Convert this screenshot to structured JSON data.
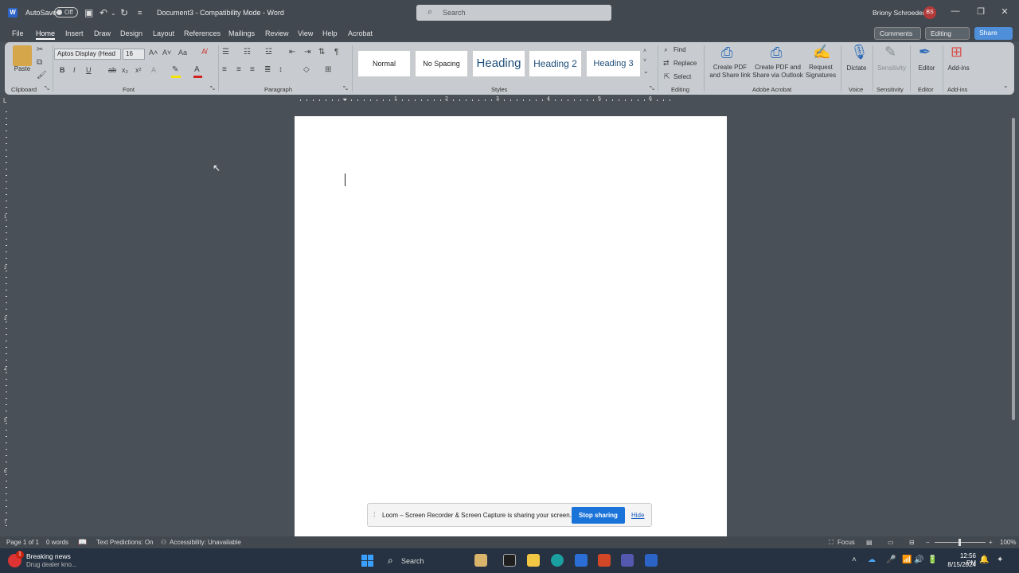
{
  "titlebar": {
    "autosave_label": "AutoSave",
    "autosave_state": "Off",
    "doc_title": "Document3 - Compatibility Mode - Word",
    "search_placeholder": "Search",
    "user_name": "Briony Schroeder",
    "user_initials": "BS"
  },
  "menu": {
    "tabs": [
      "File",
      "Home",
      "Insert",
      "Draw",
      "Design",
      "Layout",
      "References",
      "Mailings",
      "Review",
      "View",
      "Help",
      "Acrobat"
    ],
    "active_tab": "Home",
    "comments_label": "Comments",
    "editing_label": "Editing",
    "share_label": "Share"
  },
  "ribbon": {
    "clipboard": {
      "paste_label": "Paste",
      "group_label": "Clipboard"
    },
    "font": {
      "font_name": "Aptos Display (Head",
      "font_size": "16",
      "group_label": "Font"
    },
    "paragraph": {
      "group_label": "Paragraph"
    },
    "styles": {
      "items": [
        "Normal",
        "No Spacing",
        "Heading",
        "Heading 2",
        "Heading 3"
      ],
      "group_label": "Styles"
    },
    "editing": {
      "find": "Find",
      "replace": "Replace",
      "select": "Select",
      "group_label": "Editing"
    },
    "acrobat": {
      "btn1_l1": "Create PDF",
      "btn1_l2": "and Share link",
      "btn2_l1": "Create PDF and",
      "btn2_l2": "Share via Outlook",
      "btn3_l1": "Request",
      "btn3_l2": "Signatures",
      "group_label": "Adobe Acrobat"
    },
    "voice": {
      "dictate": "Dictate",
      "group_label": "Voice"
    },
    "sensitivity": {
      "button": "Sensitivity",
      "group_label": "Sensitivity"
    },
    "editor": {
      "button": "Editor",
      "group_label": "Editor"
    },
    "addins": {
      "button": "Add-ins",
      "group_label": "Add-ins"
    }
  },
  "ruler": {
    "numbers": [
      "1",
      "2",
      "3",
      "4",
      "5",
      "6"
    ]
  },
  "vruler": {
    "numbers": [
      "1",
      "2",
      "3",
      "4",
      "5",
      "6",
      "7"
    ]
  },
  "loom": {
    "message": "Loom – Screen Recorder & Screen Capture is sharing your screen.",
    "stop_label": "Stop sharing",
    "hide_label": "Hide"
  },
  "status": {
    "page": "Page 1 of 1",
    "words": "0 words",
    "text_predictions": "Text Predictions: On",
    "accessibility": "Accessibility: Unavailable",
    "focus": "Focus",
    "zoom": "100%"
  },
  "taskbar": {
    "news_badge": "1",
    "news_title": "Breaking news",
    "news_sub": "Drug dealer kno...",
    "search_label": "Search",
    "time": "12:56 PM",
    "date": "8/15/2024"
  },
  "colors": {
    "accent": "#1a73d9",
    "share": "#4f8fd9",
    "avatar": "#b33a3a",
    "font_color": "#d32020",
    "highlight": "#f5e400"
  }
}
